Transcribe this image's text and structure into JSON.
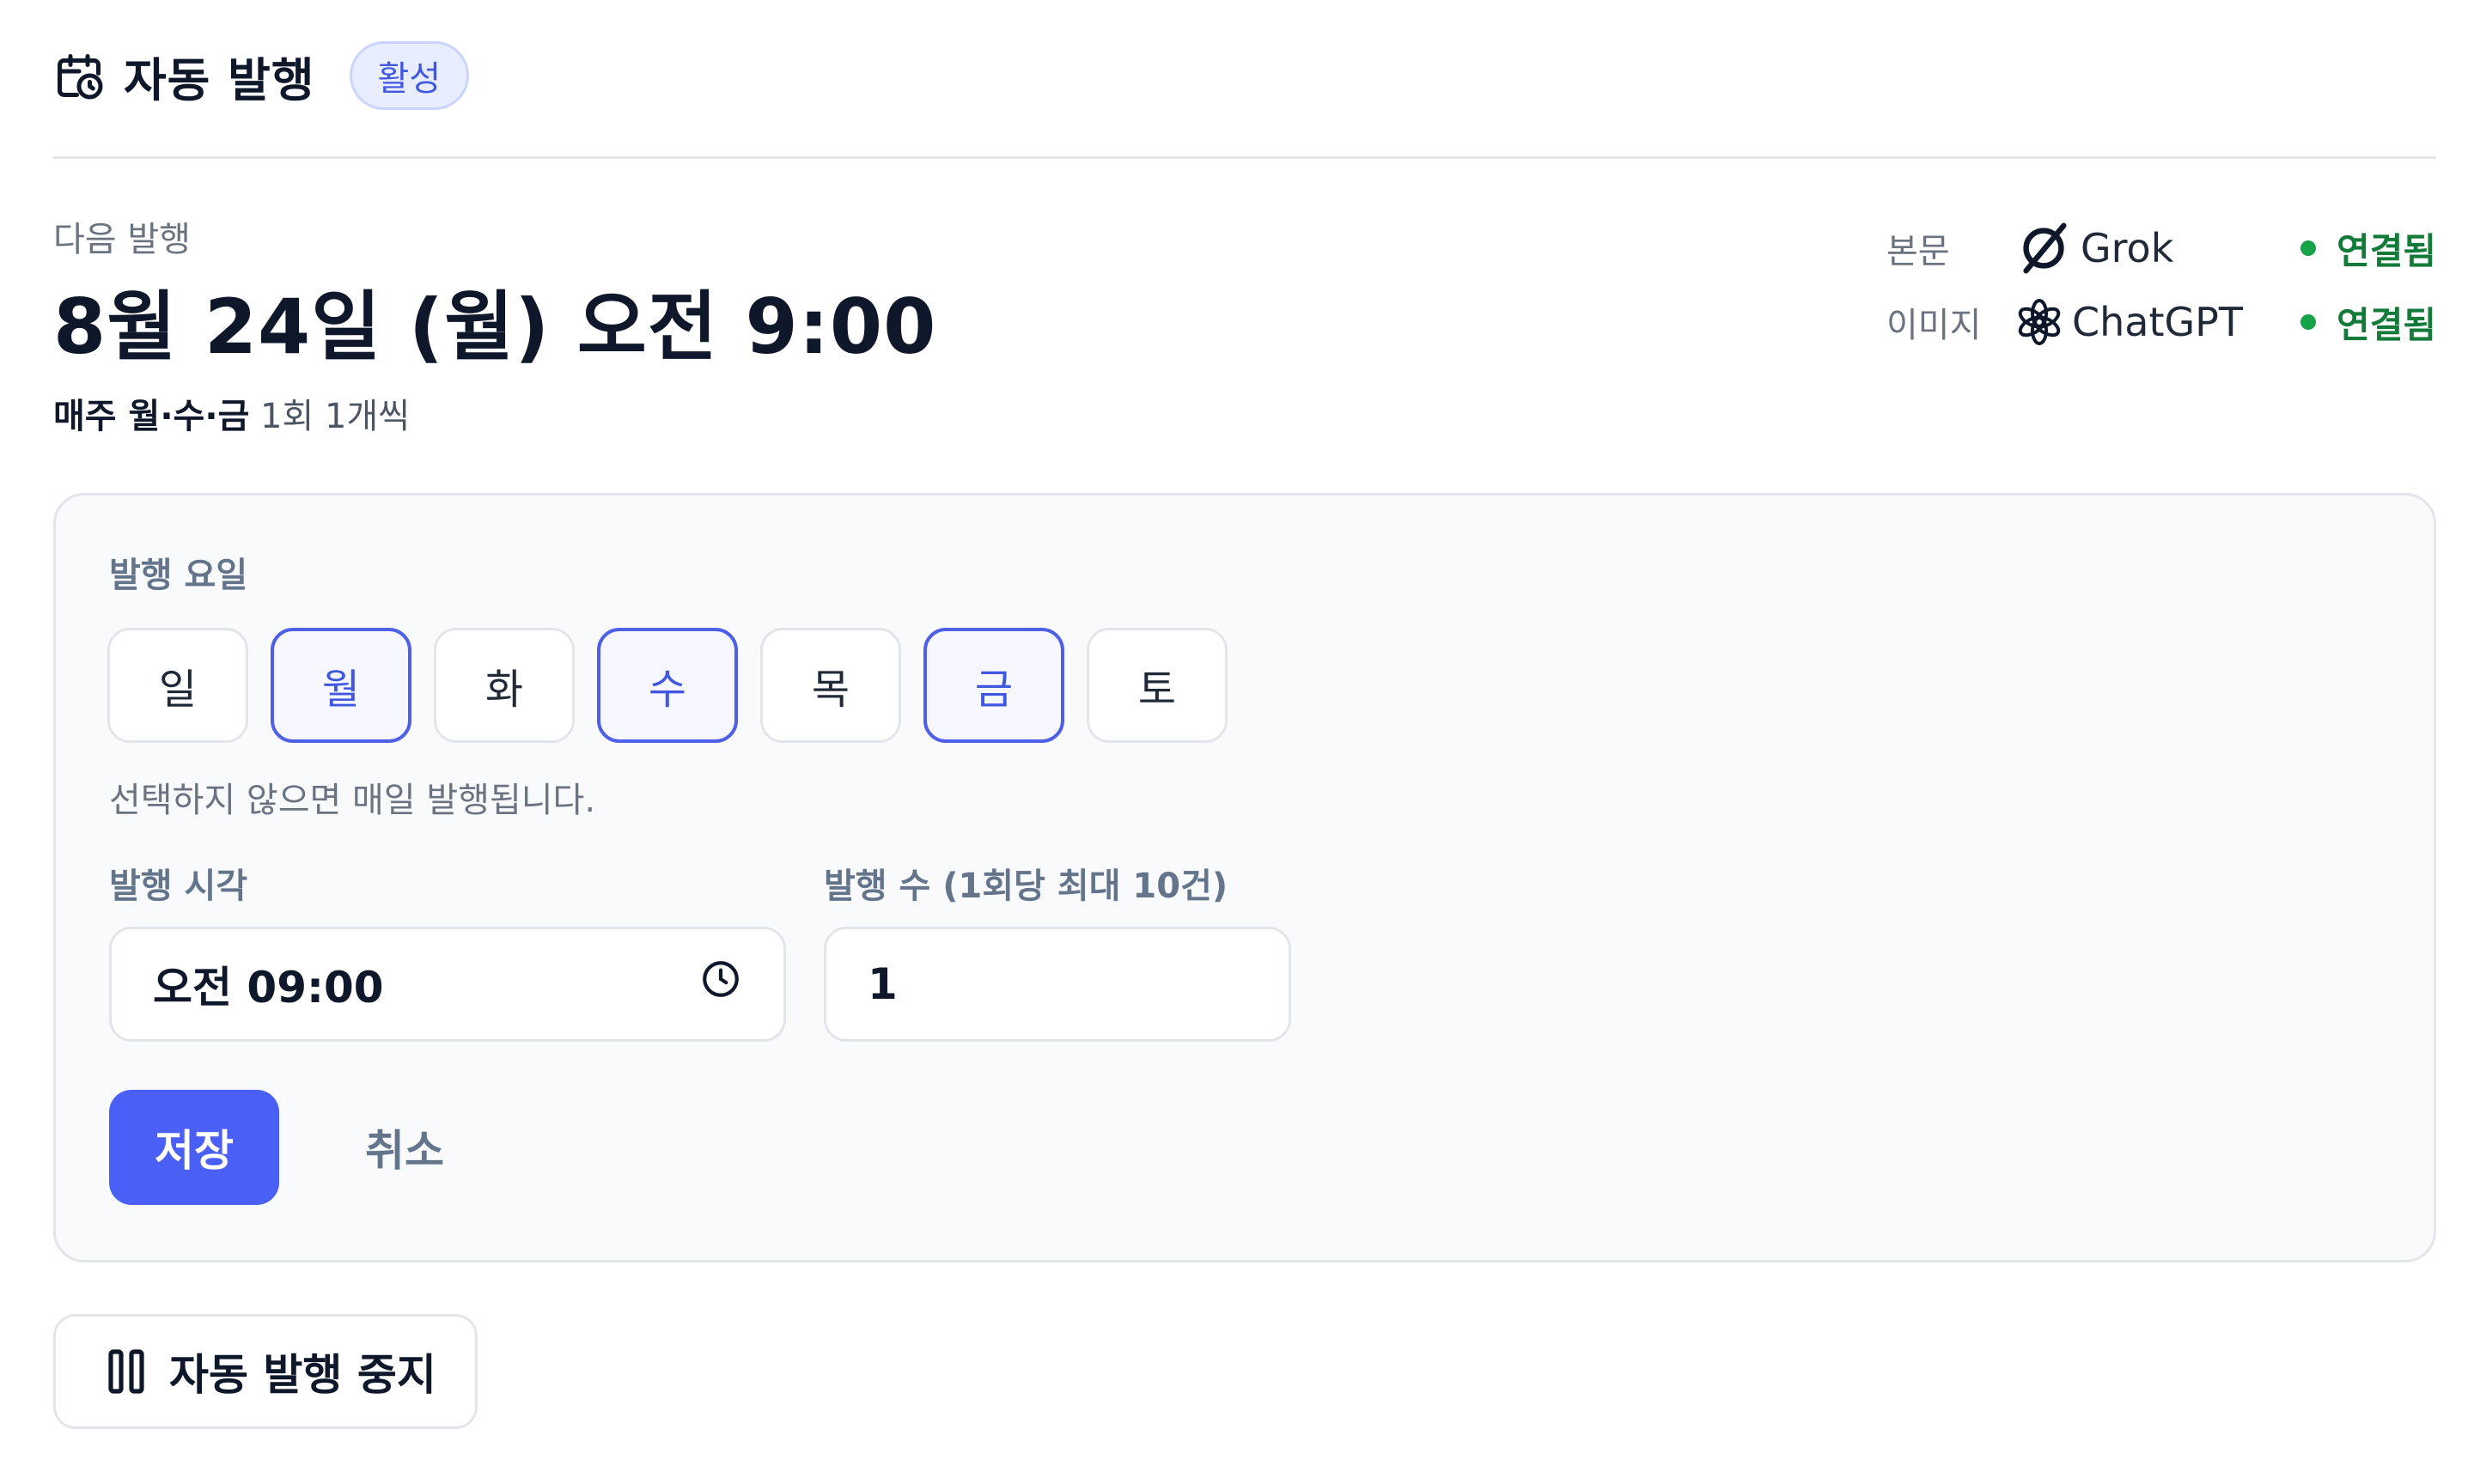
{
  "header": {
    "title": "자동 발행",
    "status_badge": "활성",
    "icon": "calendar-clock-icon"
  },
  "next": {
    "label": "다음 발행",
    "datetime": "8월 24일 (월) 오전 9:00",
    "schedule_strong": "매주 월·수·금",
    "schedule_light": "1회 1개씩"
  },
  "providers": [
    {
      "kind": "본문",
      "name": "Grok",
      "icon": "grok-logo-icon",
      "status": "연결됨"
    },
    {
      "kind": "이미지",
      "name": "ChatGPT",
      "icon": "openai-logo-icon",
      "status": "연결됨"
    }
  ],
  "colors": {
    "accent": "#4a5ff5",
    "connected": "#137a3a",
    "badge_bg": "#e8edff"
  },
  "form": {
    "days_label": "발행 요일",
    "days": [
      {
        "label": "일",
        "selected": false
      },
      {
        "label": "월",
        "selected": true
      },
      {
        "label": "화",
        "selected": false
      },
      {
        "label": "수",
        "selected": true
      },
      {
        "label": "목",
        "selected": false
      },
      {
        "label": "금",
        "selected": true
      },
      {
        "label": "토",
        "selected": false
      }
    ],
    "days_hint": "선택하지 않으면 매일 발행됩니다.",
    "time_label": "발행 시각",
    "time_value": "오전 09:00",
    "count_label": "발행 수 (1회당 최대 10건)",
    "count_value": "1",
    "save_label": "저장",
    "cancel_label": "취소"
  },
  "stop_button": {
    "label": "자동 발행 중지",
    "icon": "pause-icon"
  }
}
